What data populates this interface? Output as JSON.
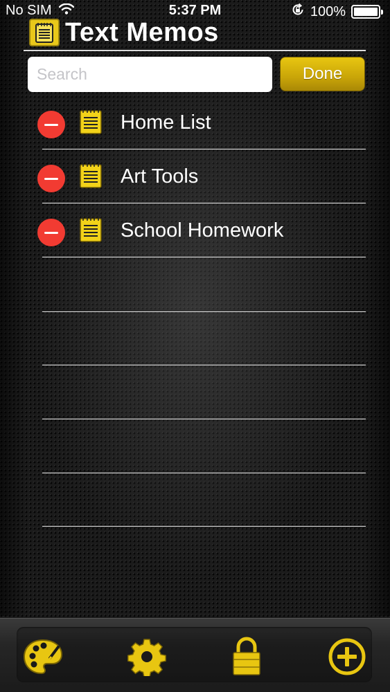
{
  "status_bar": {
    "carrier": "No SIM",
    "time": "5:37 PM",
    "battery_percent": "100%",
    "wifi_icon": "wifi-icon",
    "orientation_lock_icon": "orientation-lock-icon",
    "battery_icon": "battery-icon"
  },
  "header": {
    "title": "Text Memos",
    "icon": "notepad-icon"
  },
  "search": {
    "placeholder": "Search",
    "value": ""
  },
  "done_label": "Done",
  "memos": [
    {
      "title": "Home List"
    },
    {
      "title": "Art Tools"
    },
    {
      "title": "School Homework"
    }
  ],
  "toolbar": {
    "items": [
      "palette-icon",
      "gear-icon",
      "lock-icon",
      "add-icon"
    ]
  },
  "colors": {
    "accent_yellow": "#e8c611",
    "delete_red": "#f23b32",
    "background": "#1b1b1b"
  }
}
